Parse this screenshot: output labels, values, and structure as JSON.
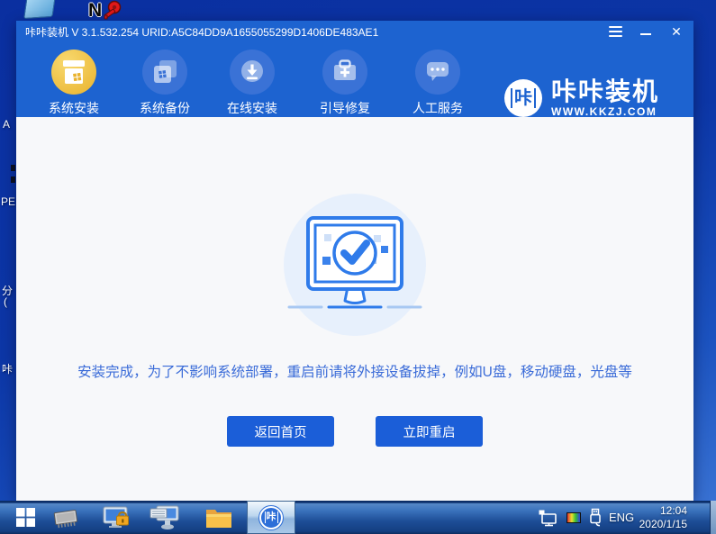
{
  "desktop": {
    "partial_labels": {
      "a": "A",
      "pe": "PE",
      "fen": "分",
      "paren": "(",
      "ka": "咔"
    }
  },
  "window": {
    "title": "咔咔装机 V 3.1.532.254 URID:A5C84DD9A1655055299D1406DE483AE1",
    "controls": {
      "close": "✕"
    }
  },
  "nav": {
    "items": [
      {
        "label": "系统安装",
        "active": true
      },
      {
        "label": "系统备份",
        "active": false
      },
      {
        "label": "在线安装",
        "active": false
      },
      {
        "label": "引导修复",
        "active": false
      },
      {
        "label": "人工服务",
        "active": false
      }
    ],
    "logo": {
      "badge": "咔",
      "name": "咔咔装机",
      "site": "WWW.KKZJ.COM"
    }
  },
  "main": {
    "message": "安装完成，为了不影响系统部署，重启前请将外接设备拔掉，例如U盘，移动硬盘，光盘等",
    "home_button": "返回首页",
    "restart_button": "立即重启"
  },
  "taskbar": {
    "kaka_badge": "咔",
    "language": "ENG",
    "time": "12:04",
    "date": "2020/1/15"
  },
  "colors": {
    "header_blue": "#1d63d0",
    "accent_gold": "#e9b22c",
    "button_blue": "#1b5ed8",
    "message_blue": "#3a6bd8",
    "illustration_blue": "#2f7bea"
  }
}
